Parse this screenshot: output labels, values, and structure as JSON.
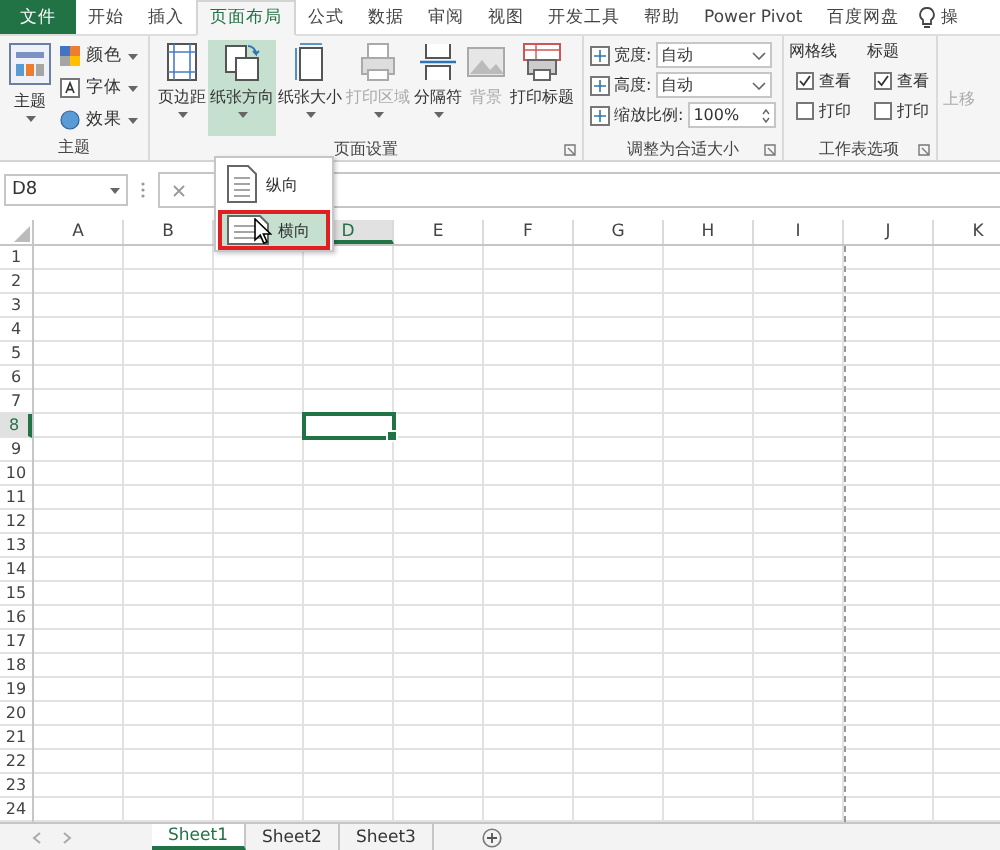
{
  "tabs": [
    {
      "label": "文件",
      "kind": "file",
      "selected": false
    },
    {
      "label": "开始",
      "kind": "tab",
      "selected": false
    },
    {
      "label": "插入",
      "kind": "tab",
      "selected": false
    },
    {
      "label": "页面布局",
      "kind": "tab",
      "selected": true
    },
    {
      "label": "公式",
      "kind": "tab",
      "selected": false
    },
    {
      "label": "数据",
      "kind": "tab",
      "selected": false
    },
    {
      "label": "审阅",
      "kind": "tab",
      "selected": false
    },
    {
      "label": "视图",
      "kind": "tab",
      "selected": false
    },
    {
      "label": "开发工具",
      "kind": "tab",
      "selected": false
    },
    {
      "label": "帮助",
      "kind": "tab",
      "selected": false
    },
    {
      "label": "Power Pivot",
      "kind": "tab",
      "selected": false
    },
    {
      "label": "百度网盘",
      "kind": "tab",
      "selected": false
    }
  ],
  "tell_me": "操",
  "theme_group": {
    "label": "主题",
    "big": "主题",
    "items": [
      {
        "label": "颜色",
        "kind": "colors"
      },
      {
        "label": "字体",
        "kind": "fonts"
      },
      {
        "label": "效果",
        "kind": "effects"
      }
    ]
  },
  "page_setup": {
    "label": "页面设置",
    "buttons": [
      {
        "label": "页边距",
        "kind": "margins",
        "dropdown": true,
        "disabled": false,
        "active": false
      },
      {
        "label": "纸张方向",
        "kind": "orientation",
        "dropdown": true,
        "disabled": false,
        "active": true
      },
      {
        "label": "纸张大小",
        "kind": "size",
        "dropdown": true,
        "disabled": false,
        "active": false
      },
      {
        "label": "打印区域",
        "kind": "print-area",
        "dropdown": true,
        "disabled": true,
        "active": false
      },
      {
        "label": "分隔符",
        "kind": "breaks",
        "dropdown": true,
        "disabled": false,
        "active": false
      },
      {
        "label": "背景",
        "kind": "background",
        "dropdown": false,
        "disabled": true,
        "active": false
      },
      {
        "label": "打印标题",
        "kind": "print-titles",
        "dropdown": false,
        "disabled": false,
        "active": false
      }
    ]
  },
  "scale": {
    "label": "调整为合适大小",
    "rows": [
      {
        "label": "宽度:",
        "value": "自动",
        "kind": "select"
      },
      {
        "label": "高度:",
        "value": "自动",
        "kind": "select"
      },
      {
        "label": "缩放比例:",
        "value": "100%",
        "kind": "spin"
      }
    ]
  },
  "sheet_options": {
    "label": "工作表选项",
    "columns": [
      {
        "title": "网格线",
        "options": [
          {
            "label": "查看",
            "checked": true
          },
          {
            "label": "打印",
            "checked": false
          }
        ]
      },
      {
        "title": "标题",
        "options": [
          {
            "label": "查看",
            "checked": true
          },
          {
            "label": "打印",
            "checked": false
          }
        ]
      }
    ]
  },
  "arrange": {
    "label": "上移",
    "disabled": true
  },
  "orientation_menu": {
    "items": [
      {
        "label": "纵向",
        "kind": "portrait",
        "selected": false
      },
      {
        "label": "横向",
        "kind": "landscape",
        "selected": true
      }
    ]
  },
  "name_box": "D8",
  "columns": [
    {
      "label": "A",
      "selected": false
    },
    {
      "label": "B",
      "selected": false
    },
    {},
    {
      "label": "D",
      "selected": true
    },
    {
      "label": "E",
      "selected": false
    },
    {
      "label": "F",
      "selected": false
    },
    {
      "label": "G",
      "selected": false
    },
    {
      "label": "H",
      "selected": false
    },
    {
      "label": "I",
      "selected": false
    },
    {
      "label": "J",
      "selected": false
    },
    {
      "label": "K",
      "selected": false
    }
  ],
  "rows": [
    {
      "label": "1",
      "selected": false
    },
    {
      "label": "2",
      "selected": false
    },
    {
      "label": "3",
      "selected": false
    },
    {
      "label": "4",
      "selected": false
    },
    {
      "label": "5",
      "selected": false
    },
    {
      "label": "6",
      "selected": false
    },
    {
      "label": "7",
      "selected": false
    },
    {
      "label": "8",
      "selected": true
    },
    {
      "label": "9",
      "selected": false
    },
    {
      "label": "10",
      "selected": false
    },
    {
      "label": "11",
      "selected": false
    },
    {
      "label": "12",
      "selected": false
    },
    {
      "label": "13",
      "selected": false
    },
    {
      "label": "14",
      "selected": false
    },
    {
      "label": "15",
      "selected": false
    },
    {
      "label": "16",
      "selected": false
    },
    {
      "label": "17",
      "selected": false
    },
    {
      "label": "18",
      "selected": false
    },
    {
      "label": "19",
      "selected": false
    },
    {
      "label": "20",
      "selected": false
    },
    {
      "label": "21",
      "selected": false
    },
    {
      "label": "22",
      "selected": false
    },
    {
      "label": "23",
      "selected": false
    },
    {
      "label": "24",
      "selected": false
    }
  ],
  "sheets": [
    {
      "label": "Sheet1",
      "selected": true
    },
    {
      "label": "Sheet2",
      "selected": false
    },
    {
      "label": "Sheet3",
      "selected": false
    }
  ]
}
